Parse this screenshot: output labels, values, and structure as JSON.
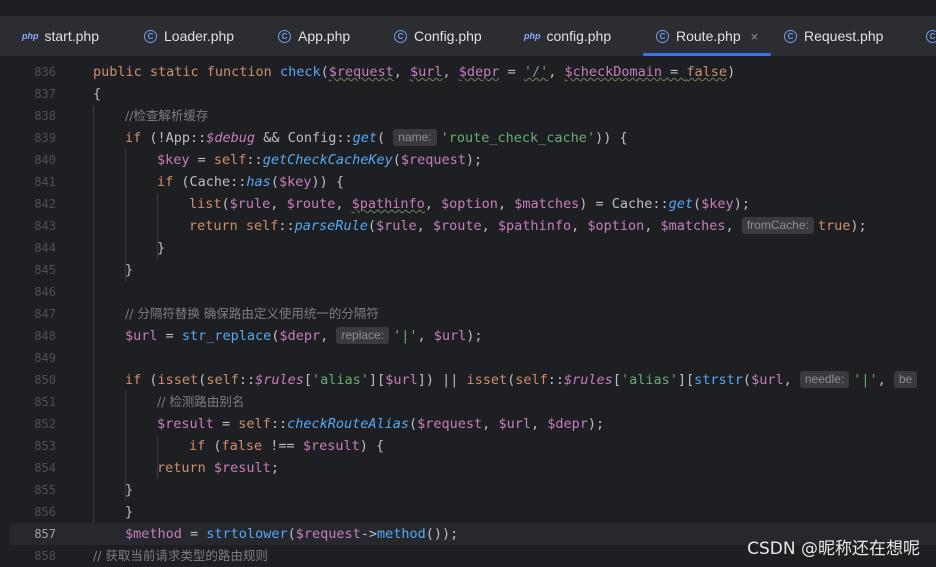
{
  "tabs": [
    {
      "label": "start.php",
      "icon": "php-file-icon",
      "active": false
    },
    {
      "label": "Loader.php",
      "icon": "php-class-icon",
      "active": false
    },
    {
      "label": "App.php",
      "icon": "php-class-icon",
      "active": false
    },
    {
      "label": "Config.php",
      "icon": "php-class-icon",
      "active": false
    },
    {
      "label": "config.php",
      "icon": "php-file-icon",
      "active": false
    },
    {
      "label": "Route.php",
      "icon": "php-class-icon",
      "active": true
    },
    {
      "label": "Request.php",
      "icon": "php-class-icon",
      "active": false
    }
  ],
  "tab_php_glyph": "php",
  "tab_class_glyph": "C",
  "close_glyph": "×",
  "current_line": "857",
  "lines": [
    {
      "n": "836",
      "t": [
        [
          "kw",
          "public static function "
        ],
        [
          "fn",
          "check"
        ],
        [
          "p",
          "("
        ],
        [
          "var sq",
          "$request"
        ],
        [
          "p",
          ", "
        ],
        [
          "var sq",
          "$url"
        ],
        [
          "p",
          ", "
        ],
        [
          "var sq",
          "$depr"
        ],
        [
          "p",
          " = "
        ],
        [
          "str sq",
          "'/'"
        ],
        [
          "p",
          ", "
        ],
        [
          "var sq",
          "$checkDomain"
        ],
        [
          "p sq",
          " = "
        ],
        [
          "kw sq",
          "false"
        ],
        [
          "p",
          ")"
        ]
      ]
    },
    {
      "n": "837",
      "t": [
        [
          "p",
          "{"
        ]
      ]
    },
    {
      "n": "838",
      "t": [
        [
          "cmt",
          "//检查解析缓存"
        ]
      ]
    },
    {
      "n": "839",
      "t": [
        [
          "kw",
          "if "
        ],
        [
          "p",
          "(!App::"
        ],
        [
          "svar",
          "$debug"
        ],
        [
          "p",
          " && Config::"
        ],
        [
          "fni",
          "get"
        ],
        [
          "p",
          "( "
        ],
        [
          "hint",
          "name:"
        ],
        [
          "str",
          "'route_check_cache'"
        ],
        [
          "p",
          ")) {"
        ]
      ]
    },
    {
      "n": "840",
      "t": [
        [
          "var",
          "$key"
        ],
        [
          "p",
          " = "
        ],
        [
          "kw",
          "self"
        ],
        [
          "p",
          "::"
        ],
        [
          "fni",
          "getCheckCacheKey"
        ],
        [
          "p",
          "("
        ],
        [
          "var",
          "$request"
        ],
        [
          "p",
          ");"
        ]
      ]
    },
    {
      "n": "841",
      "t": [
        [
          "kw",
          "if "
        ],
        [
          "p",
          "(Cache::"
        ],
        [
          "fni",
          "has"
        ],
        [
          "p",
          "("
        ],
        [
          "var",
          "$key"
        ],
        [
          "p",
          ")) {"
        ]
      ]
    },
    {
      "n": "842",
      "t": [
        [
          "kw",
          "list"
        ],
        [
          "p",
          "("
        ],
        [
          "var",
          "$rule"
        ],
        [
          "p",
          ", "
        ],
        [
          "var",
          "$route"
        ],
        [
          "p",
          ", "
        ],
        [
          "var sq",
          "$pathinfo"
        ],
        [
          "p",
          ", "
        ],
        [
          "var",
          "$option"
        ],
        [
          "p",
          ", "
        ],
        [
          "var",
          "$matches"
        ],
        [
          "p",
          ") = Cache::"
        ],
        [
          "fni",
          "get"
        ],
        [
          "p",
          "("
        ],
        [
          "var",
          "$key"
        ],
        [
          "p",
          ");"
        ]
      ]
    },
    {
      "n": "843",
      "t": [
        [
          "kw",
          "return self"
        ],
        [
          "p",
          "::"
        ],
        [
          "fni",
          "parseRule"
        ],
        [
          "p",
          "("
        ],
        [
          "var",
          "$rule"
        ],
        [
          "p",
          ", "
        ],
        [
          "var",
          "$route"
        ],
        [
          "p",
          ", "
        ],
        [
          "var",
          "$pathinfo"
        ],
        [
          "p",
          ", "
        ],
        [
          "var",
          "$option"
        ],
        [
          "p",
          ", "
        ],
        [
          "var",
          "$matches"
        ],
        [
          "p",
          ", "
        ],
        [
          "hint",
          "fromCache:"
        ],
        [
          "kw",
          "true"
        ],
        [
          "p",
          ");"
        ]
      ]
    },
    {
      "n": "844",
      "t": [
        [
          "p",
          "}"
        ]
      ]
    },
    {
      "n": "845",
      "t": [
        [
          "p",
          "}"
        ]
      ]
    },
    {
      "n": "846",
      "t": []
    },
    {
      "n": "847",
      "t": [
        [
          "cmt",
          "// 分隔符替换 确保路由定义使用统一的分隔符"
        ]
      ]
    },
    {
      "n": "848",
      "t": [
        [
          "var",
          "$url"
        ],
        [
          "p",
          " = "
        ],
        [
          "fn",
          "str_replace"
        ],
        [
          "p",
          "("
        ],
        [
          "var",
          "$depr"
        ],
        [
          "p",
          ", "
        ],
        [
          "hint",
          "replace:"
        ],
        [
          "str",
          "'|'"
        ],
        [
          "p",
          ", "
        ],
        [
          "var",
          "$url"
        ],
        [
          "p",
          ");"
        ]
      ]
    },
    {
      "n": "849",
      "t": []
    },
    {
      "n": "850",
      "t": [
        [
          "kw",
          "if "
        ],
        [
          "p",
          "("
        ],
        [
          "kw",
          "isset"
        ],
        [
          "p",
          "("
        ],
        [
          "kw",
          "self"
        ],
        [
          "p",
          "::"
        ],
        [
          "svar",
          "$rules"
        ],
        [
          "p",
          "["
        ],
        [
          "str",
          "'alias'"
        ],
        [
          "p",
          "]["
        ],
        [
          "var",
          "$url"
        ],
        [
          "p",
          "]) || "
        ],
        [
          "kw",
          "isset"
        ],
        [
          "p",
          "("
        ],
        [
          "kw",
          "self"
        ],
        [
          "p",
          "::"
        ],
        [
          "svar",
          "$rules"
        ],
        [
          "p",
          "["
        ],
        [
          "str",
          "'alias'"
        ],
        [
          "p",
          "]["
        ],
        [
          "fn",
          "strstr"
        ],
        [
          "p",
          "("
        ],
        [
          "var",
          "$url"
        ],
        [
          "p",
          ", "
        ],
        [
          "hint",
          "needle:"
        ],
        [
          "str",
          "'|'"
        ],
        [
          "p",
          ", "
        ],
        [
          "hint",
          "be"
        ]
      ]
    },
    {
      "n": "851",
      "t": [
        [
          "cmt",
          "// 检测路由别名"
        ]
      ]
    },
    {
      "n": "852",
      "t": [
        [
          "var",
          "$result"
        ],
        [
          "p",
          " = "
        ],
        [
          "kw",
          "self"
        ],
        [
          "p",
          "::"
        ],
        [
          "fni",
          "checkRouteAlias"
        ],
        [
          "p",
          "("
        ],
        [
          "var",
          "$request"
        ],
        [
          "p",
          ", "
        ],
        [
          "var",
          "$url"
        ],
        [
          "p",
          ", "
        ],
        [
          "var",
          "$depr"
        ],
        [
          "p",
          ");"
        ]
      ]
    },
    {
      "n": "853",
      "t": [
        [
          "kw",
          "if "
        ],
        [
          "p",
          "("
        ],
        [
          "kw",
          "false"
        ],
        [
          "p",
          " !== "
        ],
        [
          "var",
          "$result"
        ],
        [
          "p",
          ") {"
        ]
      ]
    },
    {
      "n": "854",
      "t": [
        [
          "kw",
          "return "
        ],
        [
          "var",
          "$result"
        ],
        [
          "p",
          ";"
        ]
      ]
    },
    {
      "n": "855",
      "t": [
        [
          "p",
          "}"
        ]
      ]
    },
    {
      "n": "856",
      "t": [
        [
          "p",
          "}"
        ]
      ]
    },
    {
      "n": "857",
      "t": [
        [
          "var",
          "$method"
        ],
        [
          "p",
          " = "
        ],
        [
          "fn",
          "strtolower"
        ],
        [
          "p",
          "("
        ],
        [
          "var",
          "$request"
        ],
        [
          "p",
          "->"
        ],
        [
          "fn",
          "method"
        ],
        [
          "p",
          "());"
        ]
      ]
    },
    {
      "n": "858",
      "t": [
        [
          "cmt",
          "// 获取当前请求类型的路由规则"
        ]
      ]
    }
  ],
  "watermark": "CSDN @昵称还在想呢"
}
